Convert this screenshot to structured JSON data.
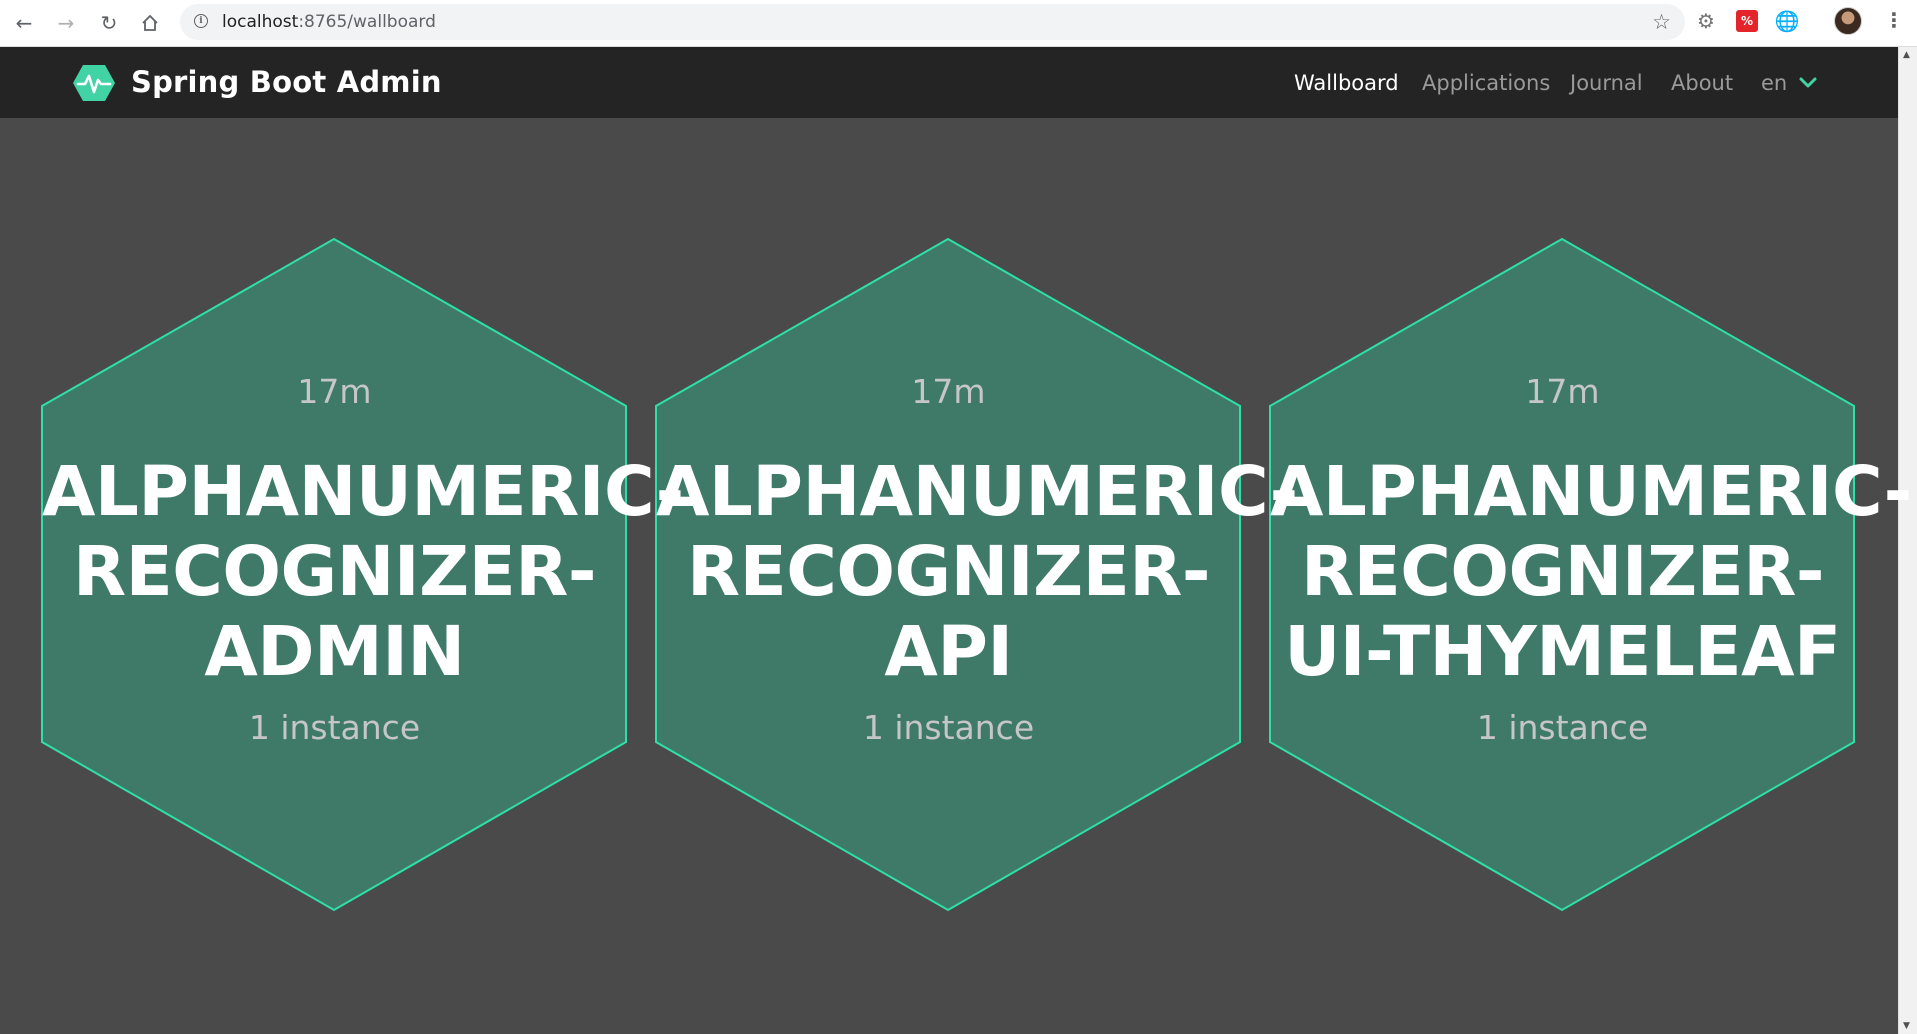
{
  "browser": {
    "url_host": "localhost",
    "url_path": ":8765/wallboard",
    "nav_icons": [
      "back-icon",
      "forward-icon",
      "reload-icon",
      "home-icon"
    ],
    "extension_icons": [
      "gear-extension-icon",
      "red-extension-icon",
      "globe-extension-icon"
    ],
    "red_extension_text": "%"
  },
  "app": {
    "brand": "Spring Boot Admin",
    "accent_color": "#42d3a5",
    "nav": [
      {
        "label": "Wallboard",
        "active": true
      },
      {
        "label": "Applications",
        "active": false
      },
      {
        "label": "Journal",
        "active": false
      },
      {
        "label": "About",
        "active": false
      }
    ],
    "language": "en"
  },
  "wallboard": {
    "hex_fill_color": "#3f7a68",
    "hex_border_color": "#2ee0a8",
    "applications": [
      {
        "uptime": "17m",
        "name_lines": [
          "ALPHANUMERIC-",
          "RECOGNIZER-",
          "ADMIN"
        ],
        "instances": "1 instance",
        "status": "up"
      },
      {
        "uptime": "17m",
        "name_lines": [
          "ALPHANUMERIC-",
          "RECOGNIZER-",
          "API"
        ],
        "instances": "1 instance",
        "status": "up"
      },
      {
        "uptime": "17m",
        "name_lines": [
          "ALPHANUMERIC-",
          "RECOGNIZER-",
          "UI-THYMELEAF"
        ],
        "instances": "1 instance",
        "status": "up"
      }
    ]
  }
}
